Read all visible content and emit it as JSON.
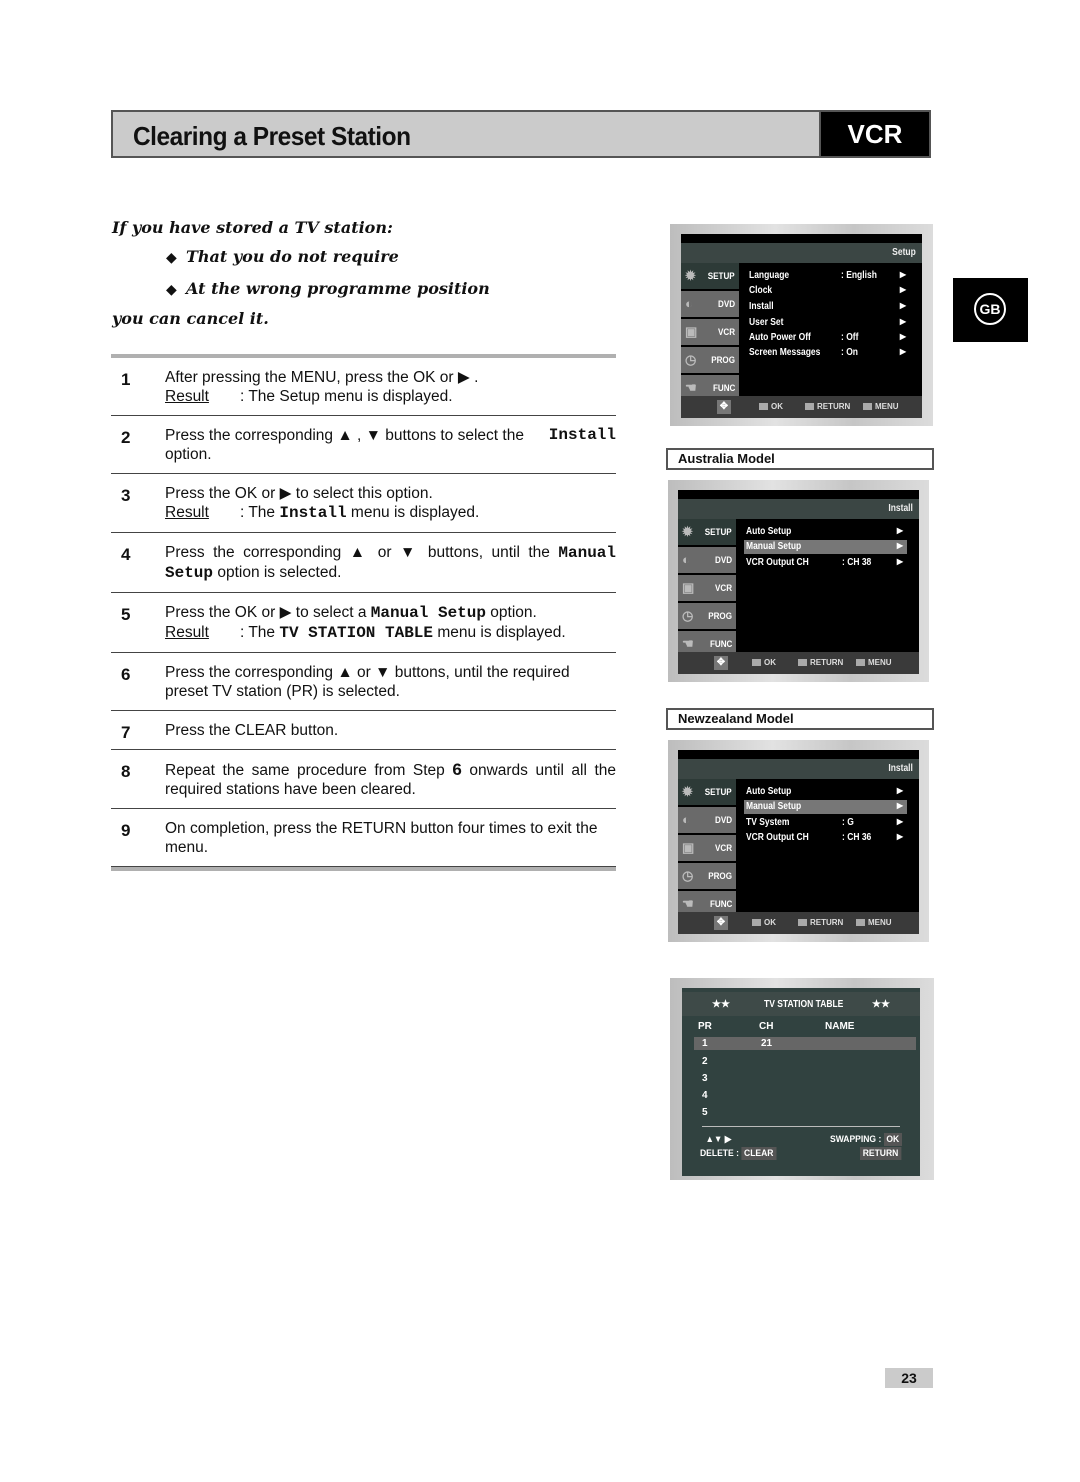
{
  "header": {
    "title": "Clearing a Preset Station",
    "badge": "VCR"
  },
  "language_badge": "GB",
  "intro": {
    "lead": "If you have stored a TV station:",
    "bullets": [
      "That you do not require",
      "At the wrong programme position"
    ],
    "tail": "you can cancel it.",
    "bullet_glyph": "◆"
  },
  "steps": [
    {
      "num": "1",
      "text": "After pressing the MENU, press the OK or ▶ .",
      "result_label": "Result",
      "result_text": "The Setup menu is displayed."
    },
    {
      "num": "2",
      "text_a": "Press the corresponding ▲ , ▼ buttons to select the",
      "code": "Install",
      "text_b": "option."
    },
    {
      "num": "3",
      "text": "Press the OK or ▶ to select this option.",
      "result_label": "Result",
      "result_pre": "The",
      "result_code": "Install",
      "result_post": "menu is displayed."
    },
    {
      "num": "4",
      "text_a": "Press the corresponding ▲ or ▼ buttons, until the",
      "code": "Manual Setup",
      "text_b": "option is selected."
    },
    {
      "num": "5",
      "text_a": "Press the OK or ▶ to select a",
      "code": "Manual Setup",
      "text_b": "option.",
      "result_label": "Result",
      "result_pre": "The",
      "result_code": "TV STATION TABLE",
      "result_post": "menu is displayed."
    },
    {
      "num": "6",
      "text": "Press the corresponding ▲ or ▼ buttons, until the required preset TV station (PR) is selected."
    },
    {
      "num": "7",
      "text": "Press the CLEAR button."
    },
    {
      "num": "8",
      "text_a": "Repeat the same procedure from Step",
      "bold": "6",
      "text_b": "onwards until all the required stations have been cleared."
    },
    {
      "num": "9",
      "text": "On completion, press the RETURN button four times to exit the menu."
    }
  ],
  "osd_common": {
    "sidebar": [
      "SETUP",
      "DVD",
      "VCR",
      "PROG",
      "FUNC"
    ],
    "footer": {
      "ok": "OK",
      "return": "RETURN",
      "menu": "MENU"
    },
    "arrow": "▶"
  },
  "screen_setup": {
    "title": "Setup",
    "items": [
      {
        "label": "Language",
        "value": ": English"
      },
      {
        "label": "Clock",
        "value": ""
      },
      {
        "label": "Install",
        "value": ""
      },
      {
        "label": "User Set",
        "value": ""
      },
      {
        "label": "Auto Power Off",
        "value": ": Off"
      },
      {
        "label": "Screen Messages",
        "value": ": On"
      }
    ]
  },
  "screen_australia": {
    "model_label": "Australia Model",
    "title": "Install",
    "items": [
      {
        "label": "Auto Setup",
        "value": ""
      },
      {
        "label": "Manual Setup",
        "value": "",
        "selected": true
      },
      {
        "label": "VCR Output CH",
        "value": ": CH 38"
      }
    ]
  },
  "screen_newzealand": {
    "model_label": "Newzealand Model",
    "title": "Install",
    "items": [
      {
        "label": "Auto Setup",
        "value": ""
      },
      {
        "label": "Manual Setup",
        "value": "",
        "selected": true
      },
      {
        "label": "TV System",
        "value": ": G"
      },
      {
        "label": "VCR Output CH",
        "value": ": CH 36"
      }
    ]
  },
  "station_table": {
    "stars": "★★",
    "title": "TV STATION TABLE",
    "columns": [
      "PR",
      "CH",
      "NAME"
    ],
    "rows": [
      {
        "pr": "1",
        "ch": "21",
        "name": ""
      },
      {
        "pr": "2",
        "ch": "",
        "name": ""
      },
      {
        "pr": "3",
        "ch": "",
        "name": ""
      },
      {
        "pr": "4",
        "ch": "",
        "name": ""
      },
      {
        "pr": "5",
        "ch": "",
        "name": ""
      }
    ],
    "nav_keys": "▲▼ ▶",
    "swapping_label": "SWAPPING :",
    "swapping_key": "OK",
    "delete_label": "DELETE :",
    "delete_key": "CLEAR",
    "return_key": "RETURN"
  },
  "page_number": "23"
}
